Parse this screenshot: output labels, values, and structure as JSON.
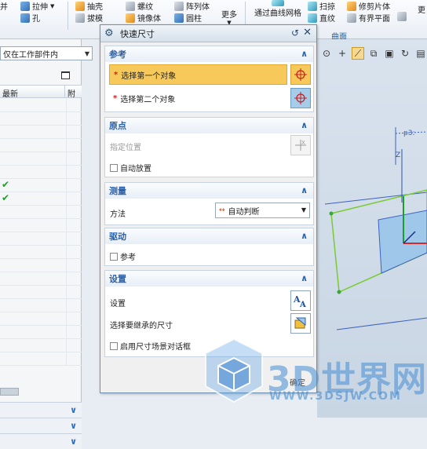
{
  "ribbon": {
    "items": [
      {
        "label": "拉伸",
        "name": "ribbon-extrude"
      },
      {
        "label": "孔",
        "name": "ribbon-hole"
      },
      {
        "label": "抽壳",
        "name": "ribbon-shell"
      },
      {
        "label": "拔模",
        "name": "ribbon-draft"
      },
      {
        "label": "螺纹",
        "name": "ribbon-thread"
      },
      {
        "label": "镜像体",
        "name": "ribbon-mirror-body"
      },
      {
        "label": "阵列体",
        "name": "ribbon-pattern-body"
      },
      {
        "label": "圆柱",
        "name": "ribbon-cylinder"
      },
      {
        "label": "更多",
        "name": "ribbon-more"
      },
      {
        "label": "通过曲线网格",
        "name": "ribbon-through-curve-mesh"
      },
      {
        "label": "扫掠",
        "name": "ribbon-sweep"
      },
      {
        "label": "直纹",
        "name": "ribbon-ruled"
      },
      {
        "label": "修剪片体",
        "name": "ribbon-trim-sheet"
      },
      {
        "label": "有界平面",
        "name": "ribbon-bounded-plane"
      },
      {
        "label": "更",
        "name": "ribbon-more-2"
      },
      {
        "label": "并",
        "name": "ribbon-unite"
      }
    ],
    "group_label": "曲面"
  },
  "left_panel": {
    "filter_value": "仅在工作部件内",
    "col_latest": "最新",
    "col_attach": "附",
    "rows": [
      false,
      false,
      false,
      false,
      false,
      false,
      true,
      true,
      false,
      false,
      false,
      false,
      false,
      false,
      false,
      false,
      false,
      false,
      false,
      false
    ]
  },
  "dialog": {
    "title": "快速尺寸",
    "sections": {
      "reference": {
        "title": "参考",
        "select_first": "选择第一个对象",
        "select_second": "选择第二个对象"
      },
      "origin": {
        "title": "原点",
        "specify_location": "指定位置",
        "auto_place": "自动放置"
      },
      "measurement": {
        "title": "测量",
        "method_label": "方法",
        "method_value": "自动判断"
      },
      "driving": {
        "title": "驱动",
        "reference": "参考"
      },
      "settings": {
        "title": "设置",
        "settings_label": "设置",
        "inherit_label": "选择要继承的尺寸",
        "scene_dialog": "启用尺寸场景对话框"
      }
    },
    "ok_label": "确定"
  },
  "viewport": {
    "dim_label": "p3:"
  },
  "watermark": {
    "brand": "3D世界网",
    "url": "WWW.3DSJW.COM"
  },
  "colors": {
    "accent_blue": "#2a61a8",
    "active_yellow": "#f7c95a",
    "required_red": "#d41f1f",
    "check_green": "#1f9e2a"
  }
}
